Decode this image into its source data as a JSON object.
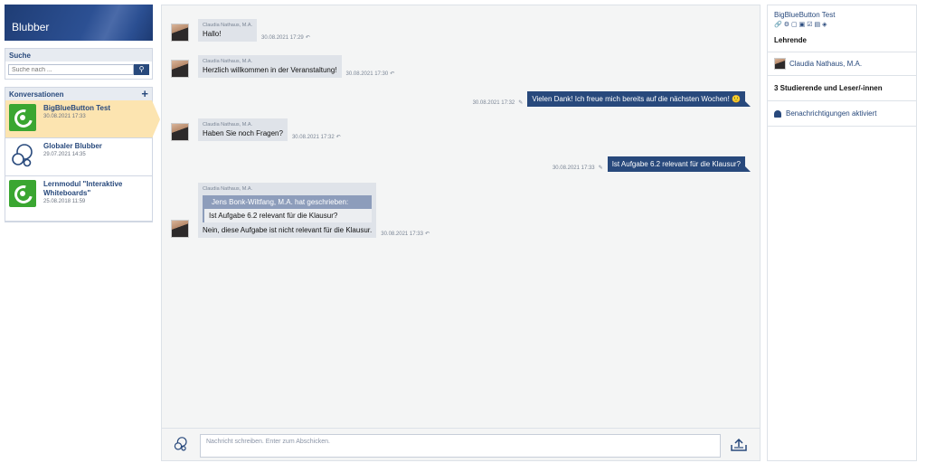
{
  "app": {
    "title": "Blubber"
  },
  "search": {
    "title": "Suche",
    "placeholder": "Suche nach ..."
  },
  "conversations": {
    "title": "Konversationen",
    "items": [
      {
        "title": "BigBlueButton Test",
        "date": "30.08.2021 17:33",
        "icon": "bbb-green-icon",
        "active": true
      },
      {
        "title": "Globaler Blubber",
        "date": "29.07.2021 14:35",
        "icon": "blubber-bubbles-icon",
        "active": false
      },
      {
        "title": "Lernmodul \"Interaktive Whiteboards\"",
        "date": "25.08.2018 11:59",
        "icon": "bbb-green-icon",
        "active": false
      }
    ]
  },
  "messages": [
    {
      "sender": "Claudia Nathaus, M.A.",
      "text": "Hallo!",
      "time": "30.08.2021 17:29"
    },
    {
      "sender": "Claudia Nathaus, M.A.",
      "text": "Herzlich willkommen in der Veranstaltung!",
      "time": "30.08.2021 17:30"
    },
    {
      "text": "Vielen Dank! Ich freue mich bereits auf die nächsten Wochen! 🙂",
      "time": "30.08.2021 17:32"
    },
    {
      "sender": "Claudia Nathaus, M.A.",
      "text": "Haben Sie noch Fragen?",
      "time": "30.08.2021 17:32"
    },
    {
      "text": "Ist Aufgabe 6.2 relevant für die Klausur?",
      "time": "30.08.2021 17:33"
    },
    {
      "sender": "Claudia Nathaus, M.A.",
      "quote_header": "Jens Bonk-Wiltfang, M.A. hat geschrieben:",
      "quote_text": "Ist Aufgabe 6.2 relevant für die Klausur?",
      "text": "Nein, diese Aufgabe ist nicht relevant für die Klausur.",
      "time": "30.08.2021 17:33"
    }
  ],
  "composer": {
    "placeholder": "Nachricht schreiben. Enter zum Abschicken."
  },
  "sidebar": {
    "course_title": "BigBlueButton Test",
    "icons": "🔗⚙▢▣☑▤◈",
    "teachers_heading": "Lehrende",
    "teacher": "Claudia Nathaus, M.A.",
    "participants": "3 Studierende und Leser/-innen",
    "notifications": "Benachrichtigungen aktiviert"
  },
  "colors": {
    "brand": "#28497c",
    "active": "#fce4b0",
    "green": "#3aa631"
  }
}
